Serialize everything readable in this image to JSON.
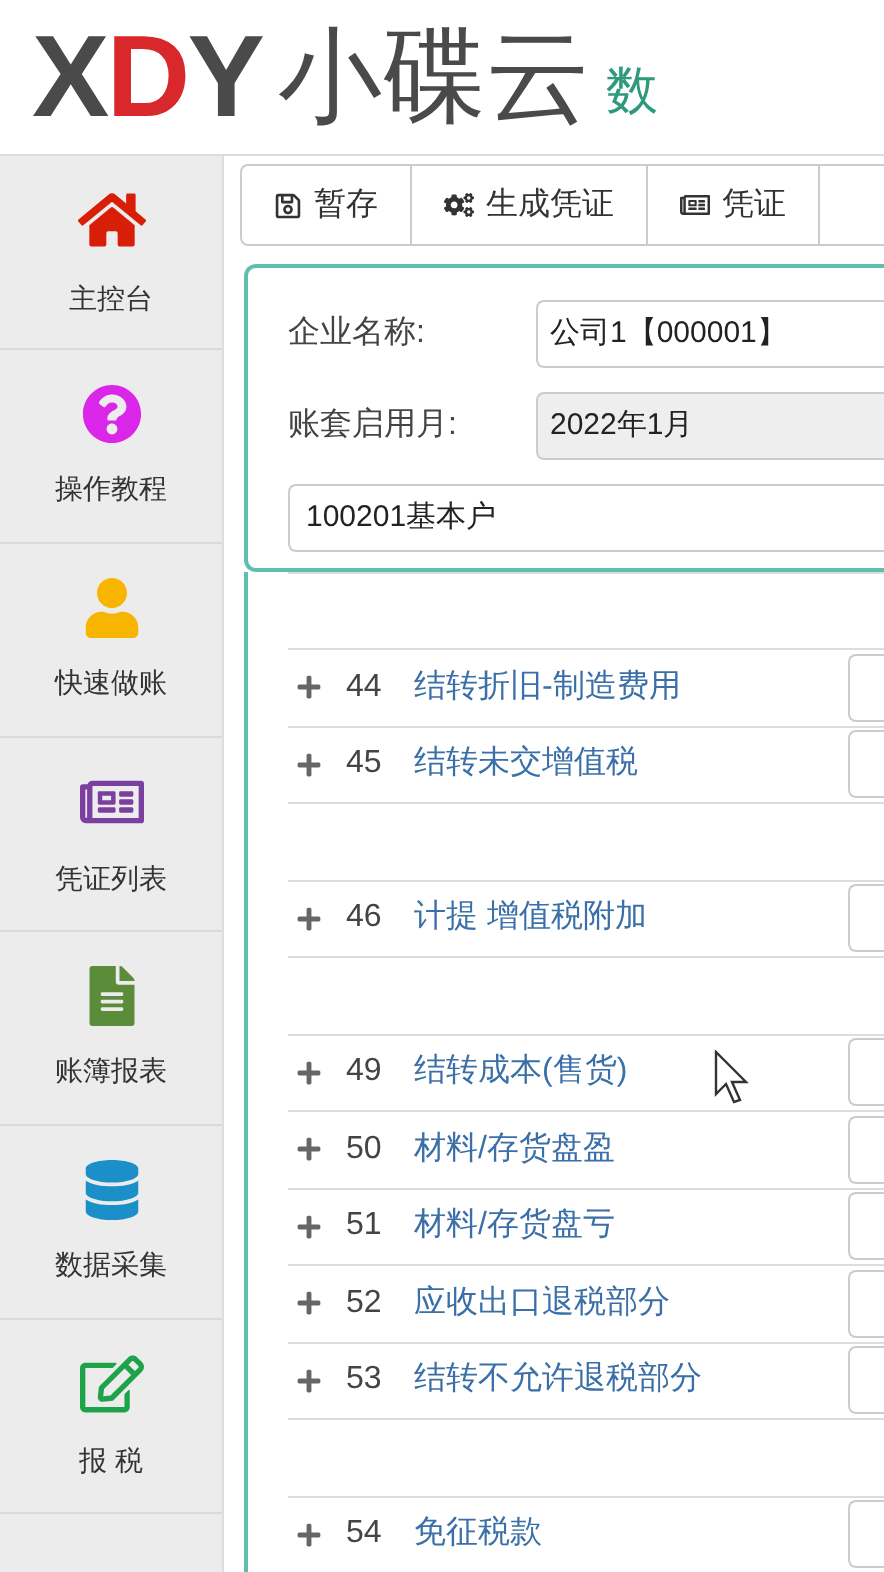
{
  "logo": {
    "letters": [
      "X",
      "D",
      "Y"
    ],
    "name": "小碟云",
    "tagline": "数"
  },
  "sidebar": {
    "items": [
      {
        "label": "主控台"
      },
      {
        "label": "操作教程"
      },
      {
        "label": "快速做账"
      },
      {
        "label": "凭证列表"
      },
      {
        "label": "账簿报表"
      },
      {
        "label": "数据采集"
      },
      {
        "label": "报 税"
      }
    ]
  },
  "toolbar": [
    {
      "label": "暂存"
    },
    {
      "label": "生成凭证"
    },
    {
      "label": "凭证"
    }
  ],
  "form": {
    "company_label": "企业名称:",
    "company_value": "公司1【000001】",
    "month_label": "账套启用月:",
    "month_value": "2022年1月",
    "account_value": "100201基本户"
  },
  "rows": [
    {
      "kind": "blank"
    },
    {
      "kind": "item",
      "number": "44",
      "label": "结转折旧-制造费用"
    },
    {
      "kind": "item",
      "number": "45",
      "label": "结转未交增值税"
    },
    {
      "kind": "blank"
    },
    {
      "kind": "item",
      "number": "46",
      "label": "计提 增值税附加"
    },
    {
      "kind": "blank"
    },
    {
      "kind": "item",
      "number": "49",
      "label": "结转成本(售货)"
    },
    {
      "kind": "item",
      "number": "50",
      "label": "材料/存货盘盈"
    },
    {
      "kind": "item",
      "number": "51",
      "label": "材料/存货盘亏"
    },
    {
      "kind": "item",
      "number": "52",
      "label": "应收出口退税部分"
    },
    {
      "kind": "item",
      "number": "53",
      "label": "结转不允许退税部分"
    },
    {
      "kind": "blank"
    },
    {
      "kind": "item",
      "number": "54",
      "label": "免征税款"
    }
  ]
}
